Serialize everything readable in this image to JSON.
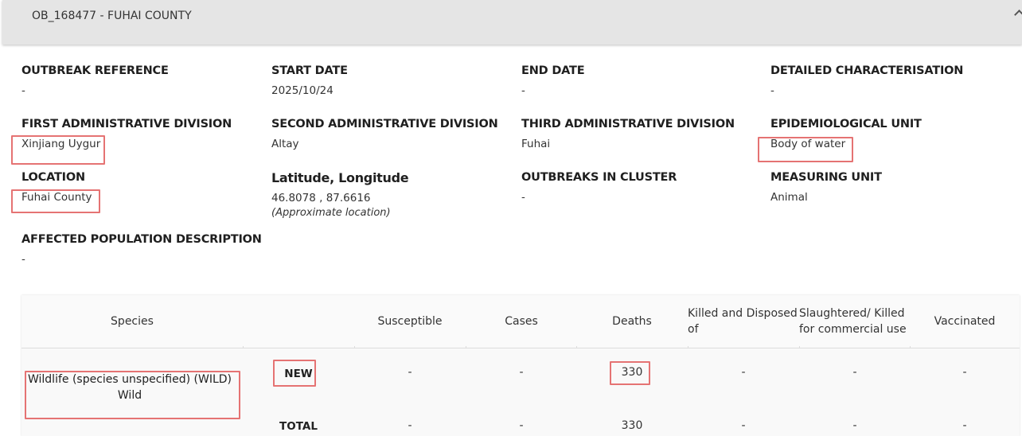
{
  "panel": {
    "title": "OB_168477 - FUHAI COUNTY",
    "chevron_icon": "chevron-up-icon"
  },
  "fields": {
    "outbreak_reference": {
      "label": "OUTBREAK REFERENCE",
      "value": "-"
    },
    "start_date": {
      "label": "START DATE",
      "value": "2025/10/24"
    },
    "end_date": {
      "label": "END DATE",
      "value": "-"
    },
    "detailed_characterisation": {
      "label": "DETAILED CHARACTERISATION",
      "value": "-"
    },
    "first_admin_division": {
      "label": "FIRST ADMINISTRATIVE DIVISION",
      "value": "Xinjiang Uygur"
    },
    "second_admin_division": {
      "label": "SECOND ADMINISTRATIVE DIVISION",
      "value": "Altay"
    },
    "third_admin_division": {
      "label": "THIRD ADMINISTRATIVE DIVISION",
      "value": "Fuhai"
    },
    "epidemiological_unit": {
      "label": "EPIDEMIOLOGICAL UNIT",
      "value": "Body of water"
    },
    "location": {
      "label": "LOCATION",
      "value": "Fuhai County"
    },
    "lat_long": {
      "label": "Latitude, Longitude",
      "value": "46.8078 , 87.6616",
      "note": "(Approximate location)"
    },
    "outbreaks_in_cluster": {
      "label": "OUTBREAKS IN CLUSTER",
      "value": "-"
    },
    "measuring_unit": {
      "label": "MEASURING UNIT",
      "value": "Animal"
    },
    "affected_population": {
      "label": "AFFECTED POPULATION DESCRIPTION",
      "value": "-"
    }
  },
  "table": {
    "headers": {
      "species": "Species",
      "susceptible": "Susceptible",
      "cases": "Cases",
      "deaths": "Deaths",
      "killed_l1": "Killed and Disposed",
      "killed_l2": "of",
      "slaughtered_l1": "Slaughtered/ Killed",
      "slaughtered_l2": "for commercial use",
      "vaccinated": "Vaccinated"
    },
    "species": {
      "line1": "Wildlife (species unspecified) (WILD)",
      "line2": "Wild"
    },
    "rows": [
      {
        "label": "NEW",
        "susceptible": "-",
        "cases": "-",
        "deaths": "330",
        "killed": "-",
        "slaughtered": "-",
        "vaccinated": "-"
      },
      {
        "label": "TOTAL",
        "susceptible": "-",
        "cases": "-",
        "deaths": "330",
        "killed": "-",
        "slaughtered": "-",
        "vaccinated": "-"
      }
    ]
  },
  "highlight_color": "#e57373"
}
